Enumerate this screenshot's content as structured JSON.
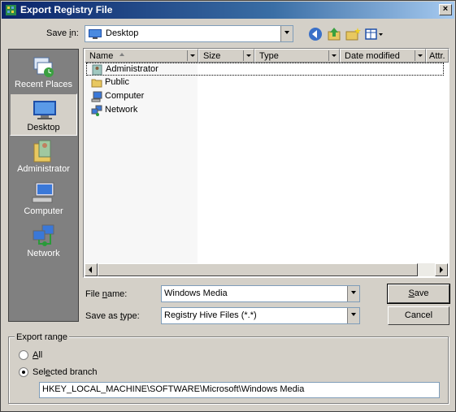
{
  "window": {
    "title": "Export Registry File",
    "close_glyph": "×"
  },
  "save_in": {
    "label_pre": "Save ",
    "label_key": "i",
    "label_post": "n:",
    "value": "Desktop"
  },
  "toolbar": {
    "icons": [
      "back-icon",
      "up-folder-icon",
      "new-folder-icon",
      "views-menu-icon"
    ]
  },
  "places": [
    {
      "label": "Recent Places",
      "icon": "recent-places-icon"
    },
    {
      "label": "Desktop",
      "icon": "desktop-icon",
      "selected": true
    },
    {
      "label": "Administrator",
      "icon": "user-folder-icon"
    },
    {
      "label": "Computer",
      "icon": "computer-icon"
    },
    {
      "label": "Network",
      "icon": "network-icon"
    }
  ],
  "file_list": {
    "columns": [
      "Name",
      "Size",
      "Type",
      "Date modified",
      "Attr."
    ],
    "items": [
      {
        "name": "Administrator",
        "icon": "user-folder-icon"
      },
      {
        "name": "Public",
        "icon": "folder-icon"
      },
      {
        "name": "Computer",
        "icon": "computer-icon"
      },
      {
        "name": "Network",
        "icon": "network-icon"
      }
    ]
  },
  "file_name": {
    "label_pre": "File ",
    "label_key": "n",
    "label_post": "ame:",
    "value": "Windows Media"
  },
  "save_as_type": {
    "label_pre": "Save as ",
    "label_key": "t",
    "label_post": "ype:",
    "value": "Registry Hive Files (*.*)"
  },
  "buttons": {
    "save_key": "S",
    "save_rest": "ave",
    "cancel": "Cancel"
  },
  "export_range": {
    "title": "Export range",
    "all_key": "A",
    "all_rest": "ll",
    "branch_pre": "Sel",
    "branch_key": "e",
    "branch_post": "cted branch",
    "branch_value": "HKEY_LOCAL_MACHINE\\SOFTWARE\\Microsoft\\Windows Media",
    "selected": "selected_branch"
  },
  "colors": {
    "title_start": "#0a246a",
    "title_end": "#a6caf0",
    "face": "#d4d0c8"
  }
}
